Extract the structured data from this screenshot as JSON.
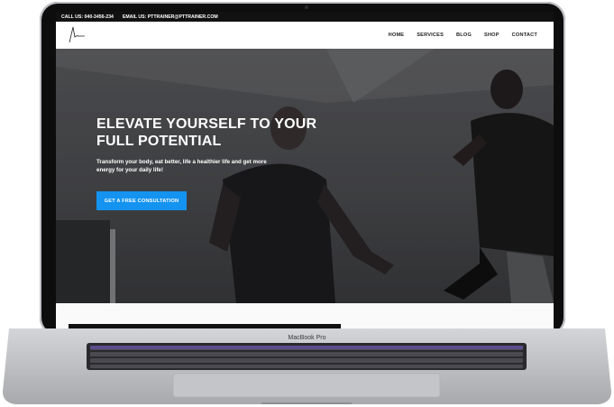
{
  "device": {
    "label": "MacBook Pro"
  },
  "topbar": {
    "call": "CALL US: 040-3456-234",
    "email": "EMAIL US: PTTRAINER@PTTRAINER.COM"
  },
  "nav": {
    "items": [
      {
        "label": "HOME"
      },
      {
        "label": "SERVICES"
      },
      {
        "label": "BLOG"
      },
      {
        "label": "SHOP"
      },
      {
        "label": "CONTACT"
      }
    ]
  },
  "hero": {
    "title_line1": "ELEVATE YOURSELF TO YOUR",
    "title_line2": "FULL POTENTIAL",
    "subtitle_line1": "Transform your body, eat better, life a healthier life and get more",
    "subtitle_line2": "energy for your daily life!",
    "cta_label": "GET A FREE CONSULTATION"
  },
  "colors": {
    "accent": "#1493f0",
    "topbar": "#111111"
  }
}
